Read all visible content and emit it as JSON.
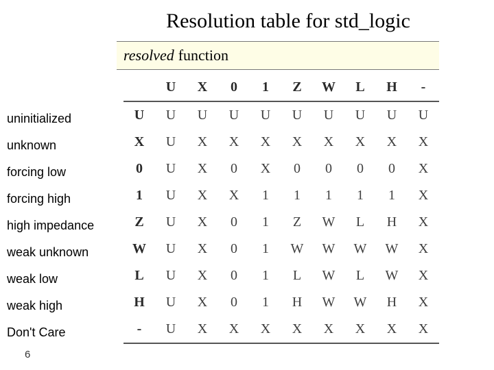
{
  "title": "Resolution table for std_logic",
  "subtitle": {
    "em": "resolved",
    "rest": " function"
  },
  "row_descriptions": [
    "uninitialized",
    "unknown",
    "forcing low",
    "forcing high",
    "high impedance",
    "weak unknown",
    "weak low",
    "weak high",
    "Don't Care"
  ],
  "chart_data": {
    "type": "table",
    "col_headers": [
      "U",
      "X",
      "0",
      "1",
      "Z",
      "W",
      "L",
      "H",
      "-"
    ],
    "row_headers": [
      "U",
      "X",
      "0",
      "1",
      "Z",
      "W",
      "L",
      "H",
      "-"
    ],
    "rows": [
      [
        "U",
        "U",
        "U",
        "U",
        "U",
        "U",
        "U",
        "U",
        "U"
      ],
      [
        "U",
        "X",
        "X",
        "X",
        "X",
        "X",
        "X",
        "X",
        "X"
      ],
      [
        "U",
        "X",
        "0",
        "X",
        "0",
        "0",
        "0",
        "0",
        "X"
      ],
      [
        "U",
        "X",
        "X",
        "1",
        "1",
        "1",
        "1",
        "1",
        "X"
      ],
      [
        "U",
        "X",
        "0",
        "1",
        "Z",
        "W",
        "L",
        "H",
        "X"
      ],
      [
        "U",
        "X",
        "0",
        "1",
        "W",
        "W",
        "W",
        "W",
        "X"
      ],
      [
        "U",
        "X",
        "0",
        "1",
        "L",
        "W",
        "L",
        "W",
        "X"
      ],
      [
        "U",
        "X",
        "0",
        "1",
        "H",
        "W",
        "W",
        "H",
        "X"
      ],
      [
        "U",
        "X",
        "X",
        "X",
        "X",
        "X",
        "X",
        "X",
        "X"
      ]
    ]
  },
  "page_number": "6"
}
